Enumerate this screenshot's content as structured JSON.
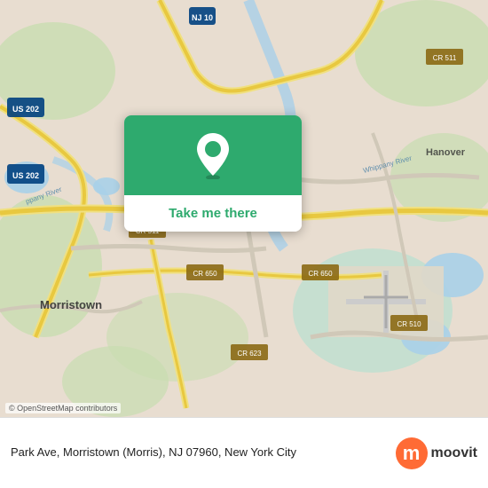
{
  "map": {
    "attribution": "© OpenStreetMap contributors",
    "background_color": "#e8e0d8"
  },
  "card": {
    "button_label": "Take me there"
  },
  "bottom_bar": {
    "address": "Park Ave, Morristown (Morris), NJ 07960, New York City",
    "attribution": "© OpenStreetMap contributors"
  },
  "moovit": {
    "logo_letter": "m",
    "brand_name": "moovit",
    "brand_color": "#ff6b35"
  },
  "icons": {
    "pin": "📍",
    "copyright": "©"
  }
}
